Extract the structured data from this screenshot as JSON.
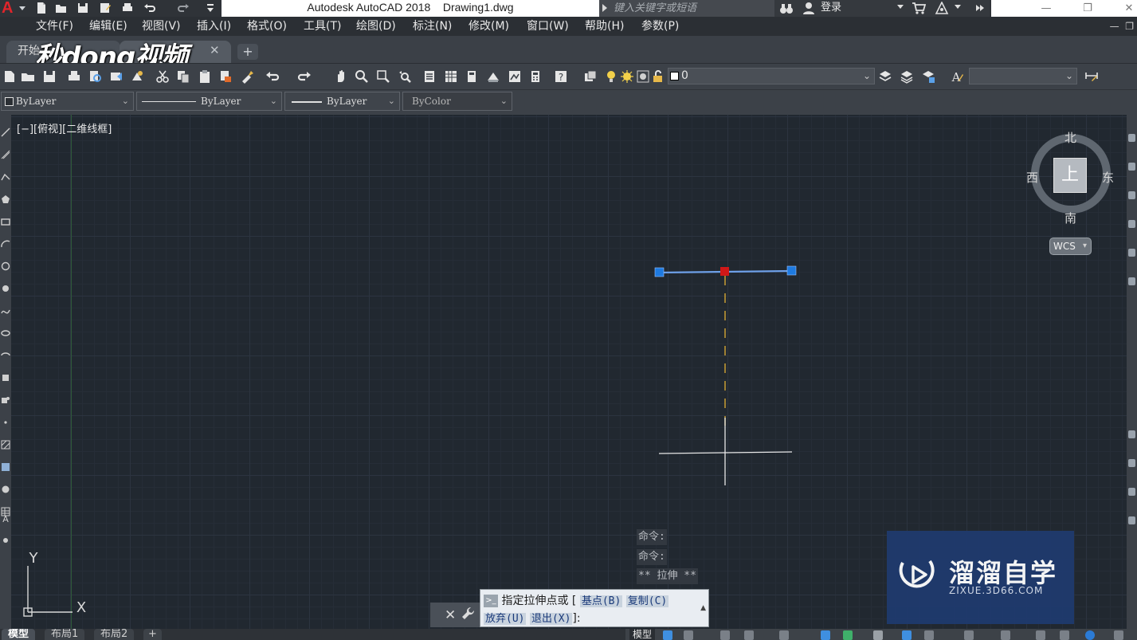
{
  "title_bar": {
    "app_title": "Autodesk AutoCAD 2018",
    "document_name": "Drawing1.dwg",
    "search_placeholder": "键入关键字或短语",
    "login_label": "登录"
  },
  "menu": {
    "items": [
      {
        "label": "文件(F)"
      },
      {
        "label": "编辑(E)"
      },
      {
        "label": "视图(V)"
      },
      {
        "label": "插入(I)"
      },
      {
        "label": "格式(O)"
      },
      {
        "label": "工具(T)"
      },
      {
        "label": "绘图(D)"
      },
      {
        "label": "标注(N)"
      },
      {
        "label": "修改(M)"
      },
      {
        "label": "窗口(W)"
      },
      {
        "label": "帮助(H)"
      },
      {
        "label": "参数(P)"
      }
    ]
  },
  "tabs": {
    "start_label": "开始",
    "new_tab_symbol": "+",
    "close_symbol": "✕"
  },
  "watermark_top": {
    "text": "秒dong视频"
  },
  "layer_toolbar": {
    "current_layer": "0"
  },
  "properties": {
    "color": "ByLayer",
    "linetype": "ByLayer",
    "lineweight": "ByLayer",
    "plotstyle": "ByColor"
  },
  "viewport": {
    "label": "[−][俯视][二维线框]"
  },
  "viewcube": {
    "face": "上",
    "north": "北",
    "south": "南",
    "east": "东",
    "west": "西",
    "wcs_label": "WCS"
  },
  "ucs": {
    "x_label": "X",
    "y_label": "Y"
  },
  "command_history": [
    {
      "text": "命令:"
    },
    {
      "text": "命令:"
    },
    {
      "text": "** 拉伸 **"
    }
  ],
  "command_line": {
    "prompt_icon": ">_",
    "prompt_text": "指定拉伸点或",
    "open_bracket": "[",
    "option_base": "基点(B)",
    "option_copy": "复制(C)",
    "option_undo": "放弃(U)",
    "option_exit": "退出(X)",
    "close_bracket": "]:"
  },
  "layout_tabs": {
    "model": "模型",
    "layout1": "布局1",
    "layout2": "布局2",
    "add": "+"
  },
  "status_bar": {
    "model_label": "模型"
  },
  "watermark_bottom": {
    "title": "溜溜自学",
    "url": "ZIXUE.3D66.COM"
  },
  "colors": {
    "canvas_bg": "#212830",
    "grip_selected": "#d01818",
    "grip_unselected": "#1e7ae0",
    "line_selected": "#6ea0e8",
    "tracking_line": "#d4a534",
    "crosshair": "#e8e8e8",
    "accent_red": "#e0252b"
  }
}
